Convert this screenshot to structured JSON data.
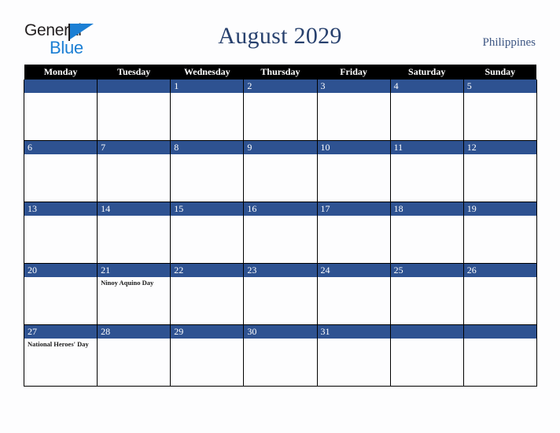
{
  "brand": {
    "line1": "General",
    "line2": "Blue",
    "flag_icon": "blue-triangle-flag-icon",
    "accent_blue": "#1b7fd4",
    "text_dark": "#231f20"
  },
  "header": {
    "title": "August 2029",
    "country": "Philippines",
    "title_color": "#28416e",
    "country_color": "#3d5683"
  },
  "calendar": {
    "theme": {
      "header_bg": "#000000",
      "header_fg": "#ffffff",
      "daynum_bg": "#2e5291",
      "daynum_fg": "#ffffff",
      "cell_bg": "#fdfdfe",
      "border": "#000000"
    },
    "weekdays": [
      "Monday",
      "Tuesday",
      "Wednesday",
      "Thursday",
      "Friday",
      "Saturday",
      "Sunday"
    ],
    "weeks": [
      [
        {
          "day": "",
          "events": []
        },
        {
          "day": "",
          "events": []
        },
        {
          "day": "1",
          "events": []
        },
        {
          "day": "2",
          "events": []
        },
        {
          "day": "3",
          "events": []
        },
        {
          "day": "4",
          "events": []
        },
        {
          "day": "5",
          "events": []
        }
      ],
      [
        {
          "day": "6",
          "events": []
        },
        {
          "day": "7",
          "events": []
        },
        {
          "day": "8",
          "events": []
        },
        {
          "day": "9",
          "events": []
        },
        {
          "day": "10",
          "events": []
        },
        {
          "day": "11",
          "events": []
        },
        {
          "day": "12",
          "events": []
        }
      ],
      [
        {
          "day": "13",
          "events": []
        },
        {
          "day": "14",
          "events": []
        },
        {
          "day": "15",
          "events": []
        },
        {
          "day": "16",
          "events": []
        },
        {
          "day": "17",
          "events": []
        },
        {
          "day": "18",
          "events": []
        },
        {
          "day": "19",
          "events": []
        }
      ],
      [
        {
          "day": "20",
          "events": []
        },
        {
          "day": "21",
          "events": [
            "Ninoy Aquino Day"
          ]
        },
        {
          "day": "22",
          "events": []
        },
        {
          "day": "23",
          "events": []
        },
        {
          "day": "24",
          "events": []
        },
        {
          "day": "25",
          "events": []
        },
        {
          "day": "26",
          "events": []
        }
      ],
      [
        {
          "day": "27",
          "events": [
            "National Heroes' Day"
          ]
        },
        {
          "day": "28",
          "events": []
        },
        {
          "day": "29",
          "events": []
        },
        {
          "day": "30",
          "events": []
        },
        {
          "day": "31",
          "events": []
        },
        {
          "day": "",
          "events": []
        },
        {
          "day": "",
          "events": []
        }
      ]
    ]
  }
}
